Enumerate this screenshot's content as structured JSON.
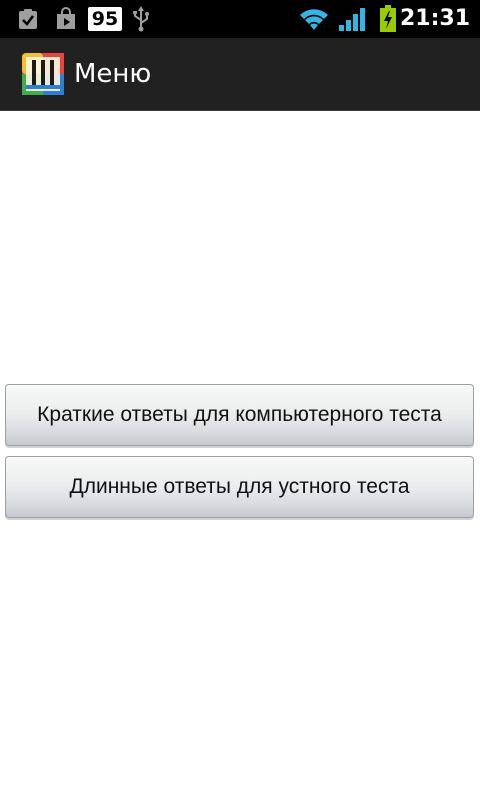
{
  "status_bar": {
    "notification_count": "95",
    "time": "21:31",
    "icons": [
      "clipboard-check-icon",
      "play-store-icon",
      "usb-icon",
      "wifi-icon",
      "signal-icon",
      "battery-charging-icon"
    ],
    "colors": {
      "background": "#000000",
      "accent": "#33b5e5",
      "battery": "#99cc00"
    }
  },
  "title_bar": {
    "title": "Меню",
    "icon": "app-logo-icon"
  },
  "menu": {
    "buttons": [
      {
        "label": "Краткие ответы для компьютерного теста"
      },
      {
        "label": "Длинные ответы для устного теста"
      }
    ]
  }
}
